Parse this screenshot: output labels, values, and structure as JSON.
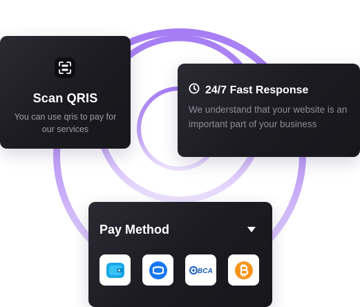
{
  "scan_card": {
    "icon": "qr-scan-icon",
    "title": "Scan QRIS",
    "description": "You can use qris to pay for our services"
  },
  "response_card": {
    "icon": "clock-icon",
    "title": "24/7 Fast Response",
    "description": "We understand that your website is an important part of your business"
  },
  "pay_card": {
    "title": "Pay Method",
    "methods": [
      {
        "name": "wallet-icon",
        "color": "#1aa7e6"
      },
      {
        "name": "ewallet-icon",
        "color": "#1877f2"
      },
      {
        "name": "bca-logo",
        "label": "BCA",
        "color": "#1b5bb6"
      },
      {
        "name": "bitcoin-icon",
        "color": "#f7931a"
      }
    ]
  },
  "colors": {
    "ring": "#a67df4",
    "card_bg": "#1d1c22"
  }
}
